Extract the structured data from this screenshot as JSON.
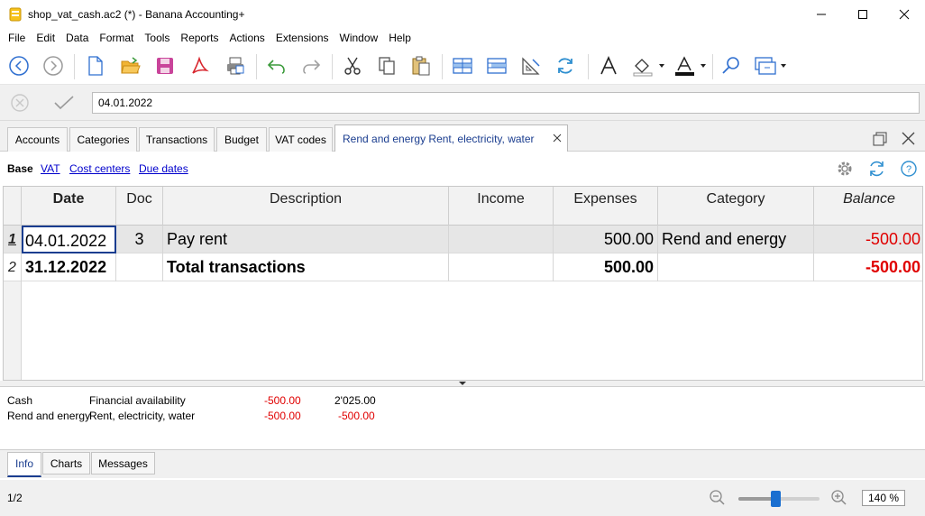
{
  "window": {
    "title": "shop_vat_cash.ac2 (*) - Banana Accounting+"
  },
  "menu": [
    "File",
    "Edit",
    "Data",
    "Format",
    "Tools",
    "Reports",
    "Actions",
    "Extensions",
    "Window",
    "Help"
  ],
  "editbar": {
    "value": "04.01.2022"
  },
  "tabs": [
    "Accounts",
    "Categories",
    "Transactions",
    "Budget",
    "VAT codes",
    "Rend and energy Rent, electricity, water"
  ],
  "views": [
    "Base",
    "VAT",
    "Cost centers",
    "Due dates"
  ],
  "table": {
    "headers": [
      "Date",
      "Doc",
      "Description",
      "Income",
      "Expenses",
      "Category",
      "Balance"
    ],
    "rows": [
      {
        "n": "1",
        "date": "04.01.2022",
        "doc": "3",
        "desc": "Pay rent",
        "income": "",
        "expenses": "500.00",
        "category": "Rend and energy",
        "balance": "-500.00"
      },
      {
        "n": "2",
        "date": "31.12.2022",
        "doc": "",
        "desc": "Total transactions",
        "income": "",
        "expenses": "500.00",
        "category": "",
        "balance": "-500.00"
      }
    ]
  },
  "info_rows": [
    {
      "account": "Cash",
      "desc": "Financial availability",
      "v1": "-500.00",
      "v2": "2'025.00"
    },
    {
      "account": "Rend and energy",
      "desc": "Rent, electricity, water",
      "v1": "-500.00",
      "v2": "-500.00"
    }
  ],
  "bottom_tabs": [
    "Info",
    "Charts",
    "Messages"
  ],
  "status": {
    "page": "1/2",
    "zoom": "140 %",
    "zoom_level_fraction": 0.45
  },
  "colors": {
    "accent": "#1a3d8f",
    "negative": "#e00000",
    "link": "#0000cc"
  }
}
